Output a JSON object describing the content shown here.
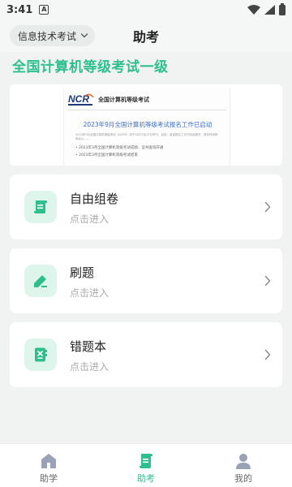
{
  "status_bar": {
    "time": "3:41",
    "notification_glyph": "A"
  },
  "header": {
    "subject_selector": "信息技术考试",
    "title": "助考"
  },
  "exam_title": "全国计算机等级考试一级",
  "banner": {
    "logo_text": "NCR",
    "site_name": "全国计算机等级考试",
    "headline": "2023年9月全国计算机等级考试报名工作已启动",
    "body": "2023年9月全国计算机等级考试（NCRE）将于9月23至25日举行。目前，各省报名工作已陆续展开，具体时间和地址以……",
    "bullets": [
      "• 2023年3月全国计算机等级考试成绩、证书查询开通",
      "• 2023年3月全国计算机等级考试结束"
    ]
  },
  "cards": [
    {
      "title": "自由组卷",
      "subtitle": "点击进入",
      "icon": "scroll-icon"
    },
    {
      "title": "刷题",
      "subtitle": "点击进入",
      "icon": "pencil-icon"
    },
    {
      "title": "错题本",
      "subtitle": "点击进入",
      "icon": "wrong-book-icon"
    }
  ],
  "bottom_nav": [
    {
      "label": "助学",
      "icon": "home-icon",
      "active": false
    },
    {
      "label": "助考",
      "icon": "exam-book-icon",
      "active": true
    },
    {
      "label": "我的",
      "icon": "user-icon",
      "active": false
    }
  ],
  "colors": {
    "accent": "#2fbf8f",
    "icon_bg": "#def5ec",
    "page_bg": "#f1f3f2",
    "inactive_icon": "#9aa3b5"
  }
}
